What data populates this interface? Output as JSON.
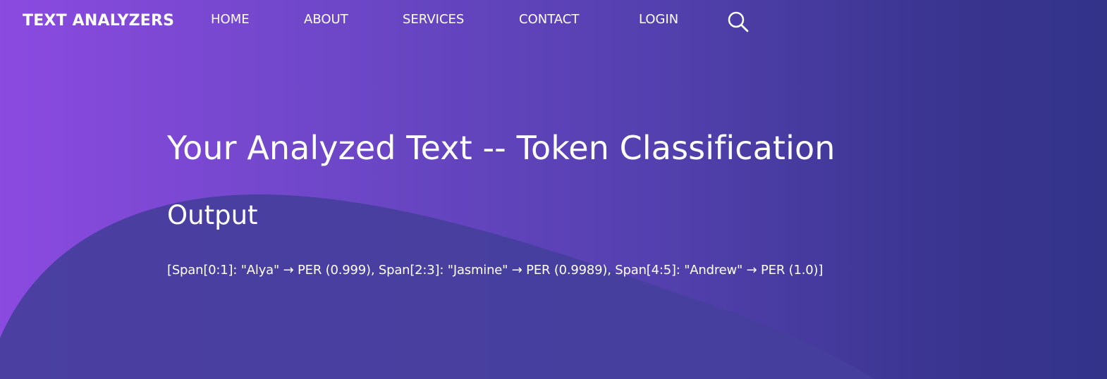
{
  "brand": "TEXT ANALYZERS",
  "nav": {
    "items": [
      "HOME",
      "ABOUT",
      "SERVICES",
      "CONTACT",
      "LOGIN"
    ],
    "search_icon": "search-icon"
  },
  "main": {
    "title": "Your Analyzed Text -- Token Classification",
    "subtitle": "Output",
    "result": "[Span[0:1]: \"Alya\" → PER (0.999), Span[2:3]: \"Jasmine\" → PER (0.9989), Span[4:5]: \"Andrew\" → PER (1.0)]"
  },
  "colors": {
    "gradient_start": "#8b4ae0",
    "gradient_end": "#33338a",
    "wave": "#453f9c",
    "text": "#ffffff"
  }
}
